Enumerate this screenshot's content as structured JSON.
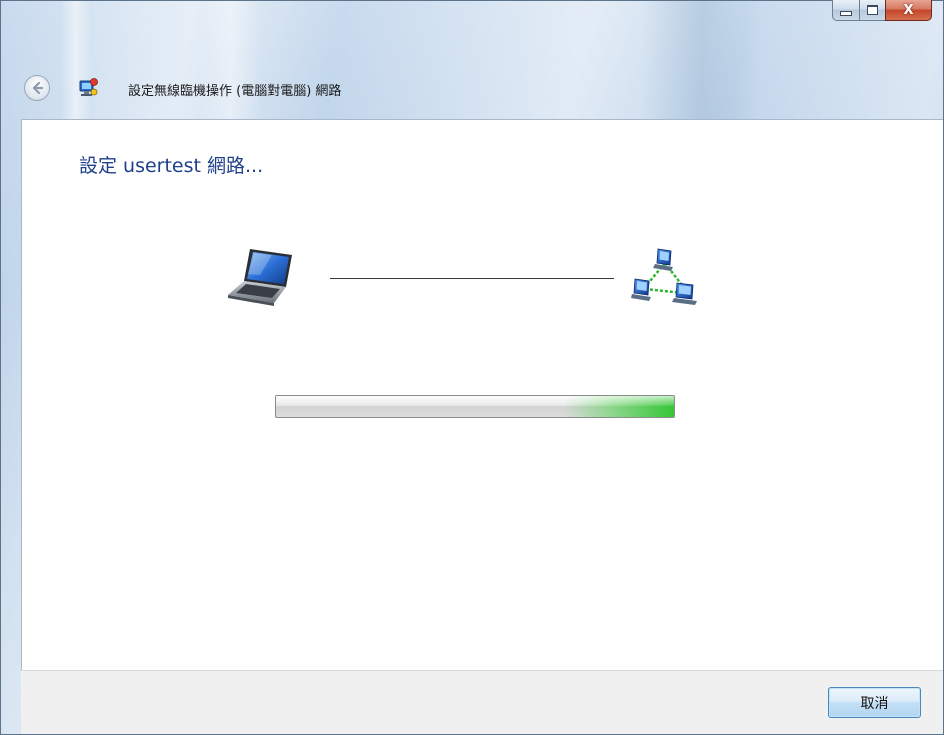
{
  "window": {
    "title": "設定無線臨機操作 (電腦對電腦) 網路",
    "controls": {
      "minimize_icon": "minimize-icon",
      "maximize_icon": "maximize-icon",
      "close_glyph": "X"
    }
  },
  "nav": {
    "back_icon": "back-arrow-icon",
    "app_icon": "network-wizard-icon"
  },
  "content": {
    "heading": "設定 usertest 網路...",
    "left_icon": "laptop-icon",
    "right_icon": "network-icon",
    "progress": {
      "mode": "marquee",
      "accent_color": "#35c635"
    }
  },
  "footer": {
    "cancel_label": "取消"
  },
  "colors": {
    "heading": "#1f3f8a",
    "frame": "#c3d6ea",
    "footer": "#f0f0f0"
  }
}
